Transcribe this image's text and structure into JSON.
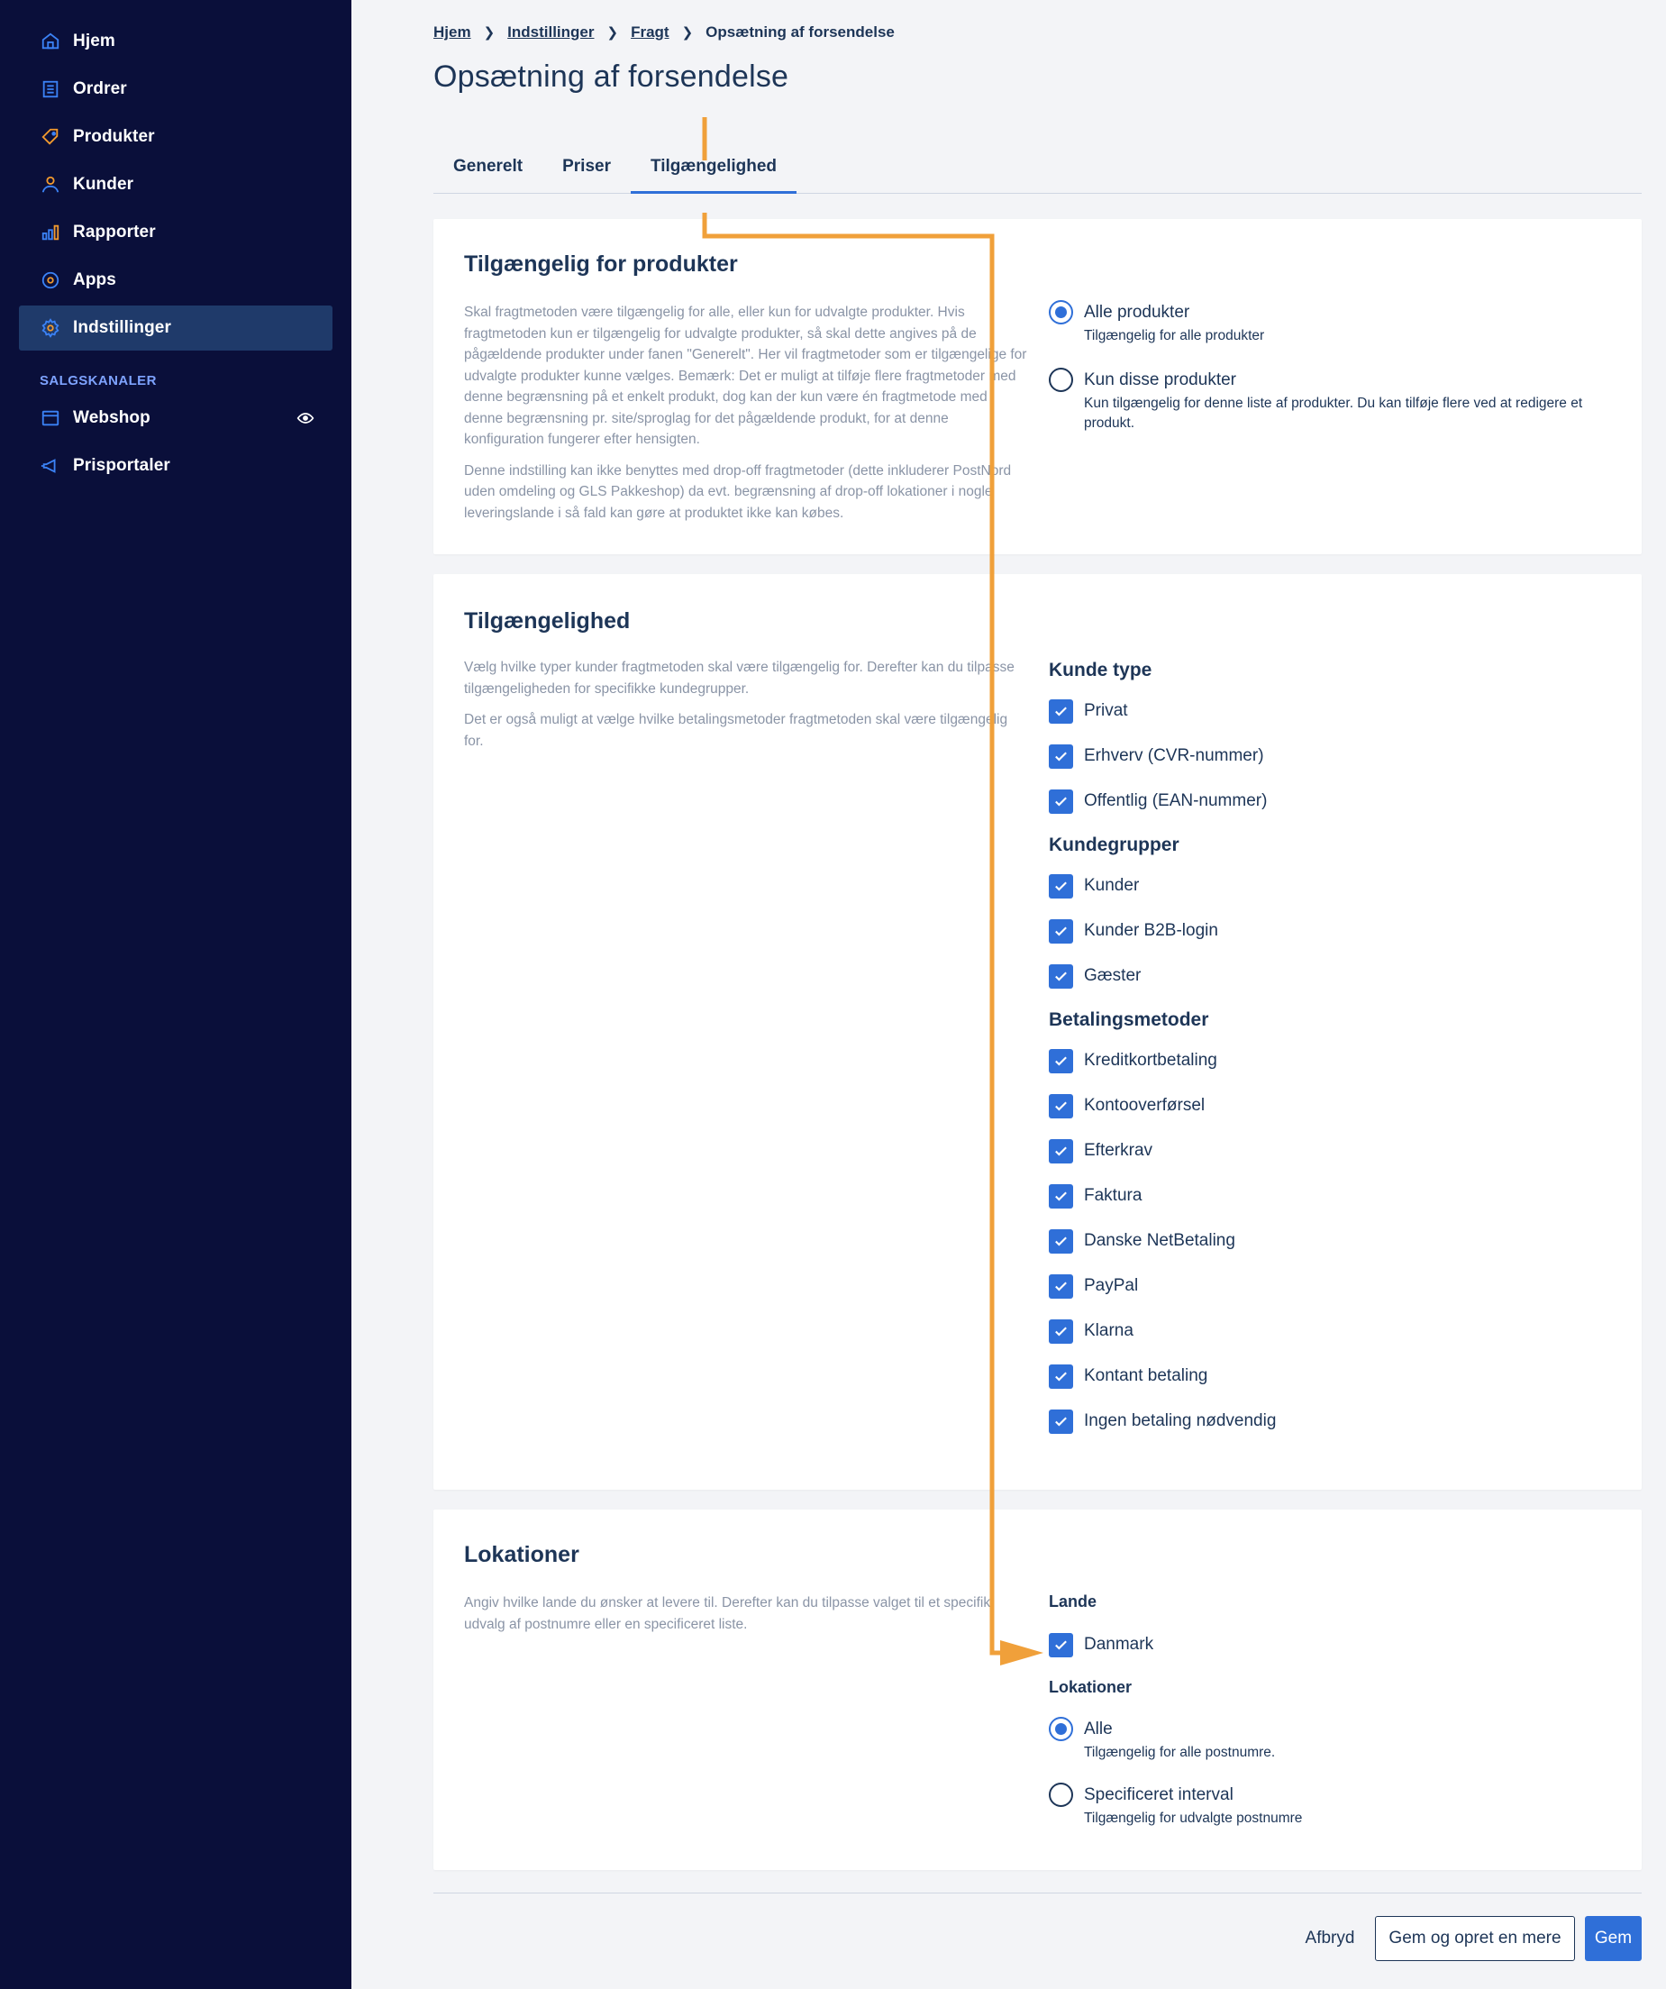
{
  "sidebar": {
    "items": [
      {
        "label": "Hjem",
        "icon": "home-icon"
      },
      {
        "label": "Ordrer",
        "icon": "orders-icon"
      },
      {
        "label": "Produkter",
        "icon": "tag-icon"
      },
      {
        "label": "Kunder",
        "icon": "user-icon"
      },
      {
        "label": "Rapporter",
        "icon": "chart-icon"
      },
      {
        "label": "Apps",
        "icon": "apps-icon"
      },
      {
        "label": "Indstillinger",
        "icon": "gear-icon",
        "active": true
      }
    ],
    "section_label": "SALGSKANALER",
    "channels": [
      {
        "label": "Webshop",
        "icon": "store-icon"
      },
      {
        "label": "Prisportaler",
        "icon": "megaphone-icon"
      }
    ]
  },
  "breadcrumb": {
    "items": [
      "Hjem",
      "Indstillinger",
      "Fragt"
    ],
    "current": "Opsætning af forsendelse"
  },
  "page_title": "Opsætning af forsendelse",
  "tabs": [
    {
      "label": "Generelt"
    },
    {
      "label": "Priser"
    },
    {
      "label": "Tilgængelighed",
      "active": true
    }
  ],
  "products_card": {
    "title": "Tilgængelig for produkter",
    "desc": [
      "Skal fragtmetoden være tilgængelig for alle, eller kun for udvalgte produkter. Hvis fragtmetoden kun er tilgængelig for udvalgte produkter, så skal dette angives på de pågældende produkter under fanen \"Generelt\". Her vil fragtmetoder som er tilgængelige for udvalgte produkter kunne vælges. Bemærk: Det er muligt at tilføje flere fragtmetoder med denne begrænsning på et enkelt produkt, dog kan der kun være én fragtmetode med denne begrænsning pr. site/sproglag for det pågældende produkt, for at denne konfiguration fungerer efter hensigten.",
      "Denne indstilling kan ikke benyttes med drop-off fragtmetoder (dette inkluderer PostNord uden omdeling og GLS Pakkeshop) da evt. begrænsning af drop-off lokationer i nogle leveringslande i så fald kan gøre at produktet ikke kan købes."
    ],
    "options": [
      {
        "label": "Alle produkter",
        "help": "Tilgængelig for alle produkter",
        "selected": true
      },
      {
        "label": "Kun disse produkter",
        "help": "Kun tilgængelig for denne liste af produkter. Du kan tilføje flere ved at redigere et produkt.",
        "selected": false
      }
    ]
  },
  "availability_card": {
    "title": "Tilgængelighed",
    "desc": [
      "Vælg hvilke typer kunder fragtmetoden skal være tilgængelig for. Derefter kan du tilpasse tilgængeligheden for specifikke kundegrupper.",
      "Det er også muligt at vælge hvilke betalingsmetoder fragtmetoden skal være tilgængelig for."
    ],
    "customer_type_title": "Kunde type",
    "customer_types": [
      "Privat",
      "Erhverv (CVR-nummer)",
      "Offentlig (EAN-nummer)"
    ],
    "customer_groups_title": "Kundegrupper",
    "customer_groups": [
      "Kunder",
      "Kunder B2B-login",
      "Gæster"
    ],
    "payment_title": "Betalingsmetoder",
    "payment_methods": [
      "Kreditkortbetaling",
      "Kontooverførsel",
      "Efterkrav",
      "Faktura",
      "Danske NetBetaling",
      "PayPal",
      "Klarna",
      "Kontant betaling",
      "Ingen betaling nødvendig"
    ]
  },
  "locations_card": {
    "title": "Lokationer",
    "desc": "Angiv hvilke lande du ønsker at levere til. Derefter kan du tilpasse valget til et specifikt udvalg af postnumre eller en specificeret liste.",
    "countries_title": "Lande",
    "countries": [
      "Danmark"
    ],
    "locations_title": "Lokationer",
    "location_options": [
      {
        "label": "Alle",
        "help": "Tilgængelig for alle postnumre.",
        "selected": true
      },
      {
        "label": "Specificeret interval",
        "help": "Tilgængelig for udvalgte postnumre",
        "selected": false
      }
    ]
  },
  "footer": {
    "cancel": "Afbryd",
    "save_and_new": "Gem og opret en mere",
    "save": "Gem"
  },
  "colors": {
    "sidebar_bg": "#0a0f3a",
    "accent": "#2f6fd8",
    "annotation": "#f0a03a",
    "text": "#1d3557"
  }
}
